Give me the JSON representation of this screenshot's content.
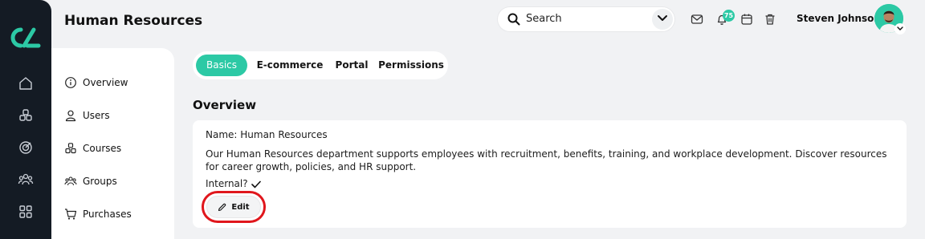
{
  "header": {
    "title": "Human Resources",
    "search_label": "Search",
    "notification_count": "75",
    "user_name": "Steven Johnson"
  },
  "rail": {
    "icons": [
      "logo",
      "home-icon",
      "courses-icon",
      "target-icon",
      "groups-icon",
      "grid-icon"
    ]
  },
  "subnav": {
    "items": [
      {
        "label": "Overview",
        "icon": "info-icon"
      },
      {
        "label": "Users",
        "icon": "user-icon"
      },
      {
        "label": "Courses",
        "icon": "boxes-icon"
      },
      {
        "label": "Groups",
        "icon": "people-icon"
      },
      {
        "label": "Purchases",
        "icon": "cart-icon"
      }
    ]
  },
  "tabs": [
    {
      "label": "Basics",
      "active": true
    },
    {
      "label": "E-commerce",
      "active": false
    },
    {
      "label": "Portal",
      "active": false
    },
    {
      "label": "Permissions",
      "active": false
    }
  ],
  "overview": {
    "section_title": "Overview",
    "name_line": "Name: Human Resources",
    "description": "Our Human Resources department supports employees with recruitment, benefits, training, and workplace development. Discover resources for career growth, policies, and HR support.",
    "internal_label": "Internal?",
    "edit_label": "Edit"
  },
  "colors": {
    "accent": "#2cc9a5",
    "rail_bg": "#141b24",
    "highlight_ring": "#e0161c"
  }
}
